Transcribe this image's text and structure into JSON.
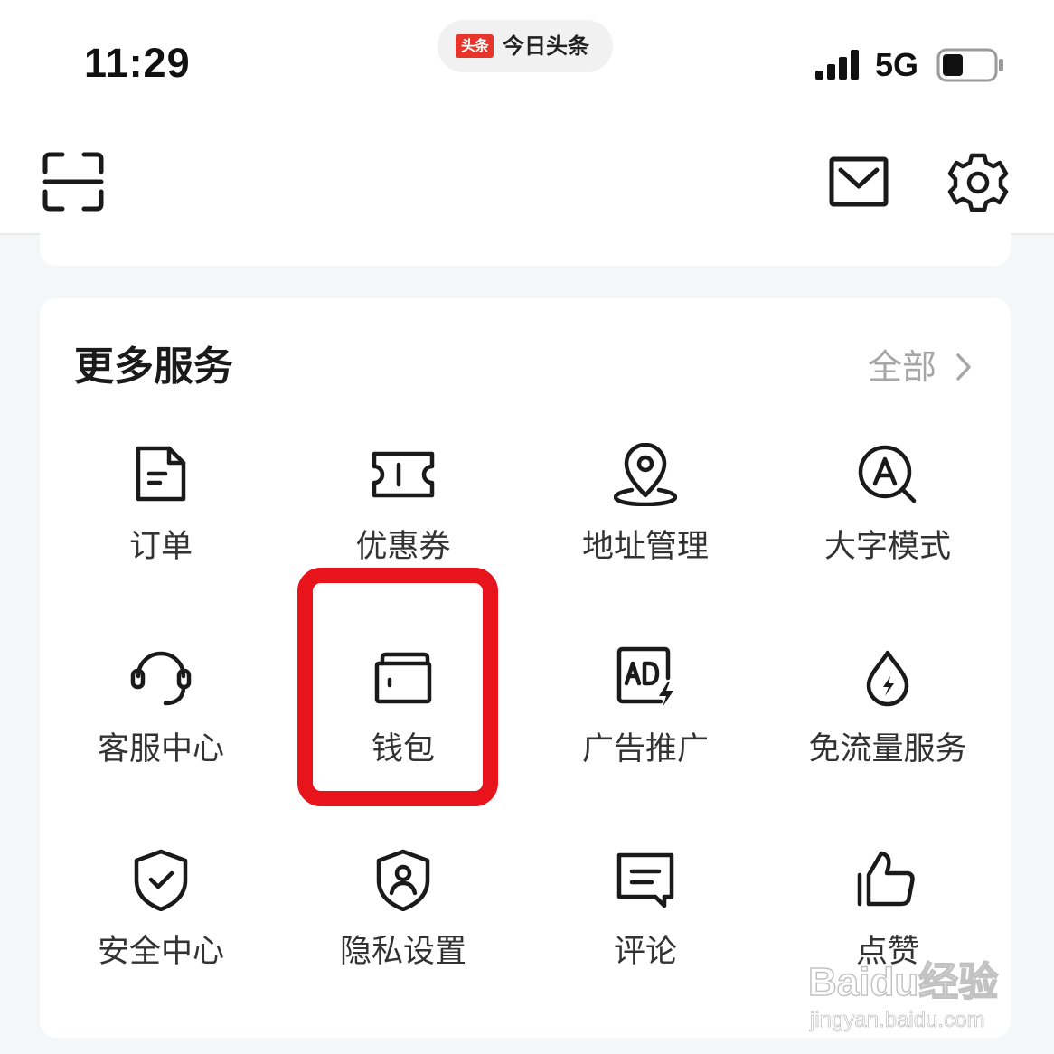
{
  "status_bar": {
    "time": "11:29",
    "app_logo_text": "头条",
    "app_name": "今日头条",
    "network": "5G",
    "battery_level": 0.4
  },
  "header": {
    "scan_icon": "scan-icon",
    "mail_icon": "mail-icon",
    "settings_icon": "gear-icon"
  },
  "services": {
    "title": "更多服务",
    "view_all": "全部",
    "items": [
      {
        "label": "订单",
        "icon": "order-icon"
      },
      {
        "label": "优惠券",
        "icon": "coupon-icon"
      },
      {
        "label": "地址管理",
        "icon": "location-icon"
      },
      {
        "label": "大字模式",
        "icon": "large-font-icon"
      },
      {
        "label": "客服中心",
        "icon": "headset-icon"
      },
      {
        "label": "钱包",
        "icon": "wallet-icon"
      },
      {
        "label": "广告推广",
        "icon": "ad-icon"
      },
      {
        "label": "免流量服务",
        "icon": "data-drop-icon"
      },
      {
        "label": "安全中心",
        "icon": "shield-check-icon"
      },
      {
        "label": "隐私设置",
        "icon": "shield-user-icon"
      },
      {
        "label": "评论",
        "icon": "comment-icon"
      },
      {
        "label": "点赞",
        "icon": "thumbs-up-icon"
      }
    ]
  },
  "highlight": {
    "target": "钱包",
    "color": "#e8141b"
  },
  "colors": {
    "accent_red": "#e8352b",
    "text_dark": "#1a1a1a",
    "text_muted": "#a6a6a6",
    "background": "#f5f6f7"
  },
  "watermark": {
    "logo": "Baidu经验",
    "url": "jingyan.baidu.com"
  }
}
